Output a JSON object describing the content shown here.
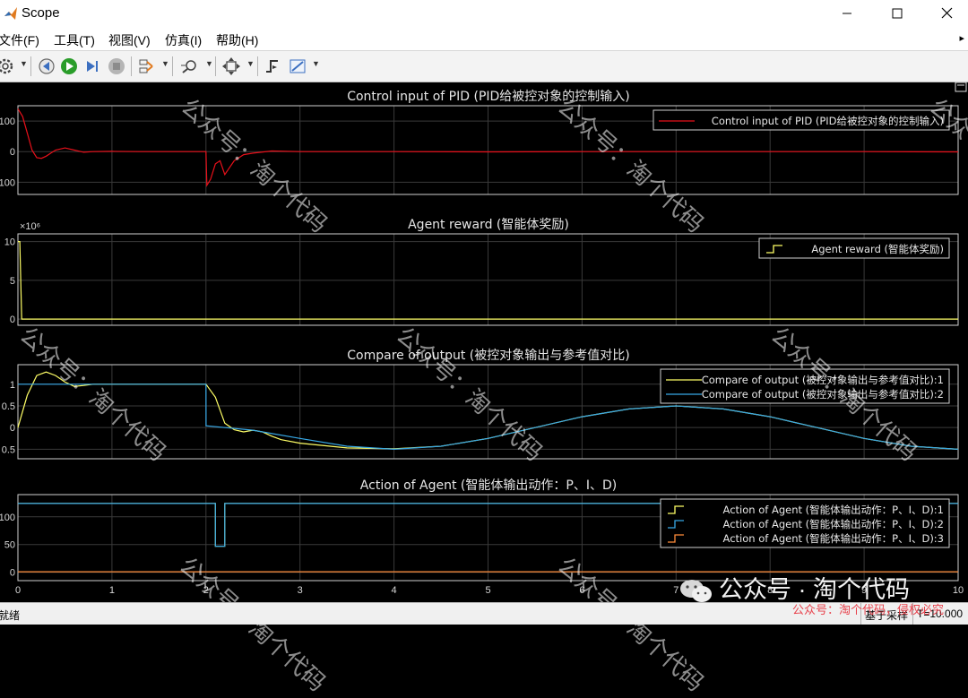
{
  "window": {
    "title": "Scope"
  },
  "menu": [
    "文件(F)",
    "工具(T)",
    "视图(V)",
    "仿真(I)",
    "帮助(H)"
  ],
  "menu_overflow_icon": "chevron-right-icon",
  "toolbar": [
    {
      "name": "settings-icon",
      "dropdown": true
    },
    {
      "name": "step-back-icon"
    },
    {
      "name": "run-icon",
      "color": "#2a9d2a"
    },
    {
      "name": "step-forward-icon"
    },
    {
      "name": "stop-icon",
      "color": "#8c8c8c"
    },
    {
      "name": "highlight-signal-icon",
      "dropdown": true
    },
    {
      "name": "zoom-icon",
      "dropdown": true
    },
    {
      "name": "autoscale-icon",
      "dropdown": true
    },
    {
      "name": "triggers-icon"
    },
    {
      "name": "measurements-icon",
      "dropdown": true
    }
  ],
  "colors": {
    "yellow": "#ffff66",
    "blue": "#37a8e6",
    "orange": "#ff8c3a",
    "red": "#e8101a",
    "axes_bg": "#000000",
    "grid": "#3a3a3a",
    "frame": "#cfcfcf"
  },
  "chart_data": [
    {
      "type": "line",
      "title": "Control input of PID (PID给被控对象的控制输入)",
      "xlim": [
        0,
        10
      ],
      "ylim": [
        -140,
        150
      ],
      "yticks": [
        -100,
        0,
        100
      ],
      "ytick_labels": [
        "100",
        "0",
        "100"
      ],
      "grid": true,
      "legend_position": "top-right",
      "series": [
        {
          "name": "Control input of PID (PID给被控对象的控制输入)",
          "color": "#e8101a",
          "x": [
            0,
            0.05,
            0.1,
            0.15,
            0.2,
            0.25,
            0.3,
            0.35,
            0.4,
            0.5,
            0.6,
            0.7,
            0.8,
            1.0,
            1.3,
            1.6,
            2.0,
            2.01,
            2.05,
            2.1,
            2.15,
            2.2,
            2.3,
            2.4,
            2.5,
            2.7,
            3.0,
            4.0,
            5.0,
            6.0,
            7.0,
            8.0,
            9.0,
            10.0
          ],
          "y": [
            140,
            115,
            60,
            5,
            -20,
            -22,
            -15,
            -5,
            5,
            12,
            5,
            -2,
            0,
            1,
            0,
            0,
            0,
            -110,
            -90,
            -40,
            -30,
            -75,
            -30,
            -10,
            -5,
            2,
            0,
            0,
            -1,
            0,
            0,
            0,
            0,
            -1
          ]
        }
      ]
    },
    {
      "type": "line",
      "title": "Agent reward (智能体奖励)",
      "exponent_label": "×10⁶",
      "xlim": [
        0,
        10
      ],
      "ylim": [
        -0.8,
        11
      ],
      "yticks": [
        0,
        5,
        10
      ],
      "ytick_labels": [
        "0",
        "5",
        "10"
      ],
      "grid": true,
      "legend_position": "top-right",
      "series": [
        {
          "name": "Agent reward (智能体奖励)",
          "color": "#ffff66",
          "step": true,
          "x": [
            0,
            0.02,
            0.04,
            10
          ],
          "y": [
            10,
            10,
            0,
            0
          ]
        }
      ]
    },
    {
      "type": "line",
      "title": "Compare of output (被控对象输出与参考值对比)",
      "xlim": [
        0,
        10
      ],
      "ylim": [
        -0.72,
        1.45
      ],
      "yticks": [
        -0.5,
        0,
        0.5,
        1
      ],
      "ytick_labels": [
        "0.5",
        "0",
        "0.5",
        "1"
      ],
      "grid": true,
      "legend_position": "top-right",
      "series": [
        {
          "name": "Compare of output (被控对象输出与参考值对比):1",
          "color": "#ffff66",
          "x": [
            0,
            0.1,
            0.2,
            0.3,
            0.4,
            0.5,
            0.6,
            0.7,
            0.8,
            1.0,
            1.5,
            2.0,
            2.1,
            2.2,
            2.3,
            2.4,
            2.5,
            2.6,
            2.7,
            2.8,
            3.0,
            3.5,
            4.0,
            4.5,
            5.0,
            5.5,
            6.0,
            6.5,
            7.0,
            7.5,
            8.0,
            8.5,
            9.0,
            9.5,
            10.0
          ],
          "y": [
            0,
            0.75,
            1.2,
            1.28,
            1.2,
            1.05,
            0.95,
            0.97,
            1.0,
            1.0,
            1.0,
            1.0,
            0.7,
            0.1,
            -0.05,
            -0.1,
            -0.06,
            -0.1,
            -0.2,
            -0.28,
            -0.36,
            -0.47,
            -0.49,
            -0.43,
            -0.25,
            0.0,
            0.25,
            0.43,
            0.5,
            0.43,
            0.25,
            0.0,
            -0.25,
            -0.43,
            -0.5
          ]
        },
        {
          "name": "Compare of output (被控对象输出与参考值对比):2",
          "color": "#37a8e6",
          "x": [
            0,
            2.0,
            2.001,
            2.5,
            3.0,
            3.5,
            4.0,
            4.5,
            5.0,
            5.5,
            6.0,
            6.5,
            7.0,
            7.5,
            8.0,
            8.5,
            9.0,
            9.5,
            10.0
          ],
          "y": [
            1.0,
            1.0,
            0.04,
            -0.06,
            -0.25,
            -0.43,
            -0.5,
            -0.43,
            -0.25,
            0.0,
            0.25,
            0.43,
            0.5,
            0.43,
            0.25,
            0.0,
            -0.25,
            -0.43,
            -0.5
          ]
        }
      ]
    },
    {
      "type": "line",
      "title": "Action of Agent (智能体输出动作：P、I、D)",
      "xlim": [
        0,
        10
      ],
      "ylim": [
        -15,
        140
      ],
      "yticks": [
        0,
        50,
        100
      ],
      "ytick_labels": [
        "0",
        "50",
        "100"
      ],
      "xticks": [
        0,
        1,
        2,
        3,
        4,
        5,
        6,
        7,
        8,
        9,
        10
      ],
      "xtick_labels": [
        "0",
        "1",
        "2",
        "3",
        "4",
        "5",
        "6",
        "7",
        "8",
        "9",
        "10"
      ],
      "grid": true,
      "legend_position": "top-right",
      "series": [
        {
          "name": "Action of Agent (智能体输出动作：P、I、D):1",
          "color": "#ffff66",
          "step": true,
          "x": [
            0,
            2.1,
            2.1,
            2.2,
            2.2,
            10
          ],
          "y": [
            124,
            124,
            47,
            47,
            124,
            124
          ]
        },
        {
          "name": "Action of Agent (智能体输出动作：P、I、D):2",
          "color": "#37a8e6",
          "step": true,
          "x": [
            0,
            2.1,
            2.1,
            2.2,
            2.2,
            10
          ],
          "y": [
            124,
            124,
            47,
            47,
            124,
            124
          ]
        },
        {
          "name": "Action of Agent (智能体输出动作：P、I、D):3",
          "color": "#ff8c3a",
          "step": true,
          "x": [
            0,
            10
          ],
          "y": [
            1,
            1
          ]
        }
      ]
    }
  ],
  "watermarks": [
    "公众号：淘个代码",
    "公众号：淘个代码",
    "公众号：淘个代码",
    "公众号：淘个代码",
    "公众号：淘个代码",
    "公众号：淘个代码",
    "公众号：淘个代码",
    "公众号：淘个代码"
  ],
  "wechat_badge": "公众号 · 淘个代码",
  "red_watermark": "公众号：淘个代码，侵权必究",
  "status": {
    "left": "就绪",
    "mode": "基于采样",
    "time": "T=10.000"
  }
}
